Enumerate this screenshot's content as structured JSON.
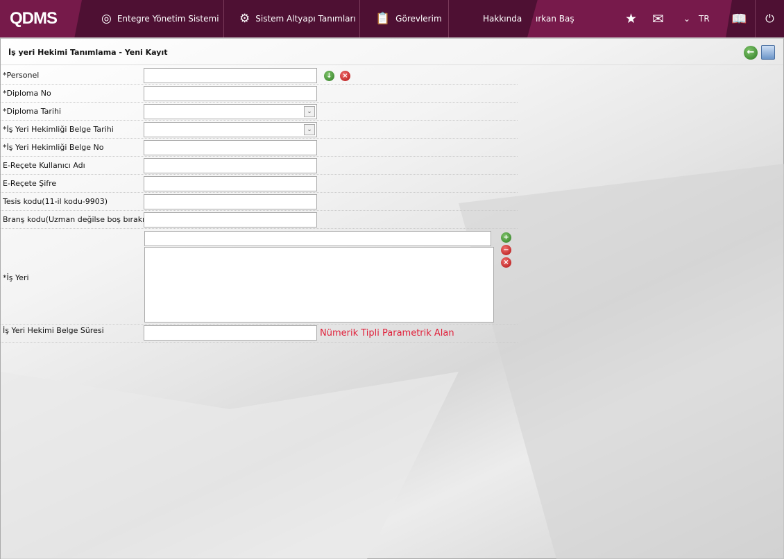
{
  "header": {
    "logo": "QDMS",
    "nav": [
      {
        "label": "Entegre Yönetim Sistemi",
        "icon": "qdms-circle-icon"
      },
      {
        "label": "Sistem Altyapı Tanımları",
        "icon": "gear-icon"
      },
      {
        "label": "Görevlerim",
        "icon": "clipboard-check-icon"
      }
    ],
    "about": "Hakkında",
    "user": "ırkan Baş",
    "language": "TR",
    "icons": [
      "star-icon",
      "mail-icon",
      "chevron-down-icon",
      "manual-book-icon",
      "power-icon"
    ]
  },
  "page": {
    "title": "İş yeri Hekimi Tanımlama - Yeni Kayıt",
    "toolbar": [
      "back-icon",
      "save-icon"
    ]
  },
  "form": {
    "fields": [
      {
        "label": "*Personel",
        "value": ""
      },
      {
        "label": "*Diploma No",
        "value": ""
      },
      {
        "label": "*Diploma Tarihi",
        "value": ""
      },
      {
        "label": "*İş Yeri Hekimliği Belge Tarihi",
        "value": ""
      },
      {
        "label": "*İş Yeri Hekimliği Belge No",
        "value": ""
      },
      {
        "label": "E-Reçete Kullanıcı Adı",
        "value": ""
      },
      {
        "label": "E-Reçete Şifre",
        "value": ""
      },
      {
        "label": "Tesis kodu(11-il kodu-9903)",
        "value": ""
      },
      {
        "label": "Branş kodu(Uzman değilse boş bırakın)",
        "value": ""
      }
    ],
    "workplace": {
      "label": "*İş Yeri",
      "value": "",
      "list": ""
    },
    "duration": {
      "label": "İş Yeri Hekimi Belge Süresi",
      "value": "",
      "hint": "Nümerik Tipli Parametrik Alan"
    },
    "colors": {
      "header": "#4e1033",
      "accent": "#771a4b",
      "hint": "#e0203a"
    }
  }
}
